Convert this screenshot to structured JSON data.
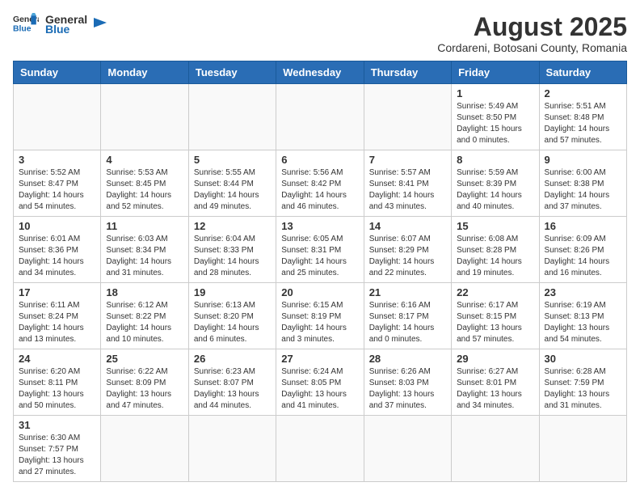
{
  "logo": {
    "text_general": "General",
    "text_blue": "Blue"
  },
  "title": "August 2025",
  "subtitle": "Cordareni, Botosani County, Romania",
  "weekdays": [
    "Sunday",
    "Monday",
    "Tuesday",
    "Wednesday",
    "Thursday",
    "Friday",
    "Saturday"
  ],
  "weeks": [
    [
      {
        "day": "",
        "info": ""
      },
      {
        "day": "",
        "info": ""
      },
      {
        "day": "",
        "info": ""
      },
      {
        "day": "",
        "info": ""
      },
      {
        "day": "",
        "info": ""
      },
      {
        "day": "1",
        "info": "Sunrise: 5:49 AM\nSunset: 8:50 PM\nDaylight: 15 hours and 0 minutes."
      },
      {
        "day": "2",
        "info": "Sunrise: 5:51 AM\nSunset: 8:48 PM\nDaylight: 14 hours and 57 minutes."
      }
    ],
    [
      {
        "day": "3",
        "info": "Sunrise: 5:52 AM\nSunset: 8:47 PM\nDaylight: 14 hours and 54 minutes."
      },
      {
        "day": "4",
        "info": "Sunrise: 5:53 AM\nSunset: 8:45 PM\nDaylight: 14 hours and 52 minutes."
      },
      {
        "day": "5",
        "info": "Sunrise: 5:55 AM\nSunset: 8:44 PM\nDaylight: 14 hours and 49 minutes."
      },
      {
        "day": "6",
        "info": "Sunrise: 5:56 AM\nSunset: 8:42 PM\nDaylight: 14 hours and 46 minutes."
      },
      {
        "day": "7",
        "info": "Sunrise: 5:57 AM\nSunset: 8:41 PM\nDaylight: 14 hours and 43 minutes."
      },
      {
        "day": "8",
        "info": "Sunrise: 5:59 AM\nSunset: 8:39 PM\nDaylight: 14 hours and 40 minutes."
      },
      {
        "day": "9",
        "info": "Sunrise: 6:00 AM\nSunset: 8:38 PM\nDaylight: 14 hours and 37 minutes."
      }
    ],
    [
      {
        "day": "10",
        "info": "Sunrise: 6:01 AM\nSunset: 8:36 PM\nDaylight: 14 hours and 34 minutes."
      },
      {
        "day": "11",
        "info": "Sunrise: 6:03 AM\nSunset: 8:34 PM\nDaylight: 14 hours and 31 minutes."
      },
      {
        "day": "12",
        "info": "Sunrise: 6:04 AM\nSunset: 8:33 PM\nDaylight: 14 hours and 28 minutes."
      },
      {
        "day": "13",
        "info": "Sunrise: 6:05 AM\nSunset: 8:31 PM\nDaylight: 14 hours and 25 minutes."
      },
      {
        "day": "14",
        "info": "Sunrise: 6:07 AM\nSunset: 8:29 PM\nDaylight: 14 hours and 22 minutes."
      },
      {
        "day": "15",
        "info": "Sunrise: 6:08 AM\nSunset: 8:28 PM\nDaylight: 14 hours and 19 minutes."
      },
      {
        "day": "16",
        "info": "Sunrise: 6:09 AM\nSunset: 8:26 PM\nDaylight: 14 hours and 16 minutes."
      }
    ],
    [
      {
        "day": "17",
        "info": "Sunrise: 6:11 AM\nSunset: 8:24 PM\nDaylight: 14 hours and 13 minutes."
      },
      {
        "day": "18",
        "info": "Sunrise: 6:12 AM\nSunset: 8:22 PM\nDaylight: 14 hours and 10 minutes."
      },
      {
        "day": "19",
        "info": "Sunrise: 6:13 AM\nSunset: 8:20 PM\nDaylight: 14 hours and 6 minutes."
      },
      {
        "day": "20",
        "info": "Sunrise: 6:15 AM\nSunset: 8:19 PM\nDaylight: 14 hours and 3 minutes."
      },
      {
        "day": "21",
        "info": "Sunrise: 6:16 AM\nSunset: 8:17 PM\nDaylight: 14 hours and 0 minutes."
      },
      {
        "day": "22",
        "info": "Sunrise: 6:17 AM\nSunset: 8:15 PM\nDaylight: 13 hours and 57 minutes."
      },
      {
        "day": "23",
        "info": "Sunrise: 6:19 AM\nSunset: 8:13 PM\nDaylight: 13 hours and 54 minutes."
      }
    ],
    [
      {
        "day": "24",
        "info": "Sunrise: 6:20 AM\nSunset: 8:11 PM\nDaylight: 13 hours and 50 minutes."
      },
      {
        "day": "25",
        "info": "Sunrise: 6:22 AM\nSunset: 8:09 PM\nDaylight: 13 hours and 47 minutes."
      },
      {
        "day": "26",
        "info": "Sunrise: 6:23 AM\nSunset: 8:07 PM\nDaylight: 13 hours and 44 minutes."
      },
      {
        "day": "27",
        "info": "Sunrise: 6:24 AM\nSunset: 8:05 PM\nDaylight: 13 hours and 41 minutes."
      },
      {
        "day": "28",
        "info": "Sunrise: 6:26 AM\nSunset: 8:03 PM\nDaylight: 13 hours and 37 minutes."
      },
      {
        "day": "29",
        "info": "Sunrise: 6:27 AM\nSunset: 8:01 PM\nDaylight: 13 hours and 34 minutes."
      },
      {
        "day": "30",
        "info": "Sunrise: 6:28 AM\nSunset: 7:59 PM\nDaylight: 13 hours and 31 minutes."
      }
    ],
    [
      {
        "day": "31",
        "info": "Sunrise: 6:30 AM\nSunset: 7:57 PM\nDaylight: 13 hours and 27 minutes."
      },
      {
        "day": "",
        "info": ""
      },
      {
        "day": "",
        "info": ""
      },
      {
        "day": "",
        "info": ""
      },
      {
        "day": "",
        "info": ""
      },
      {
        "day": "",
        "info": ""
      },
      {
        "day": "",
        "info": ""
      }
    ]
  ]
}
